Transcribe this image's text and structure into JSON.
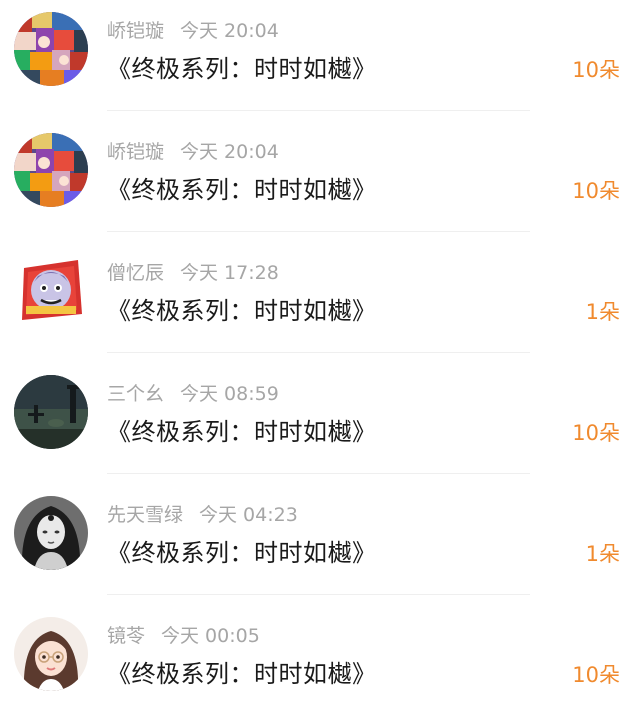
{
  "gifts": [
    {
      "user": "峤铠璇",
      "time": "今天 20:04",
      "title": "《终极系列：时时如樾》",
      "amount": "10朵",
      "avatar_icon": "anime-collage-avatar"
    },
    {
      "user": "峤铠璇",
      "time": "今天 20:04",
      "title": "《终极系列：时时如樾》",
      "amount": "10朵",
      "avatar_icon": "anime-collage-avatar"
    },
    {
      "user": "僧忆辰",
      "time": "今天 17:28",
      "title": "《终极系列：时时如樾》",
      "amount": "1朵",
      "avatar_icon": "cartoon-emblem-avatar"
    },
    {
      "user": "三个幺",
      "time": "今天 08:59",
      "title": "《终极系列：时时如樾》",
      "amount": "10朵",
      "avatar_icon": "dark-landscape-avatar"
    },
    {
      "user": "先天雪绿",
      "time": "今天 04:23",
      "title": "《终极系列：时时如樾》",
      "amount": "1朵",
      "avatar_icon": "monochrome-portrait-avatar"
    },
    {
      "user": "镜苓",
      "time": "今天 00:05",
      "title": "《终极系列：时时如樾》",
      "amount": "10朵",
      "avatar_icon": "illustrated-girl-avatar"
    }
  ],
  "colors": {
    "accent": "#f08a2e",
    "meta": "#a6a6a6",
    "title": "#1a1a1a"
  }
}
